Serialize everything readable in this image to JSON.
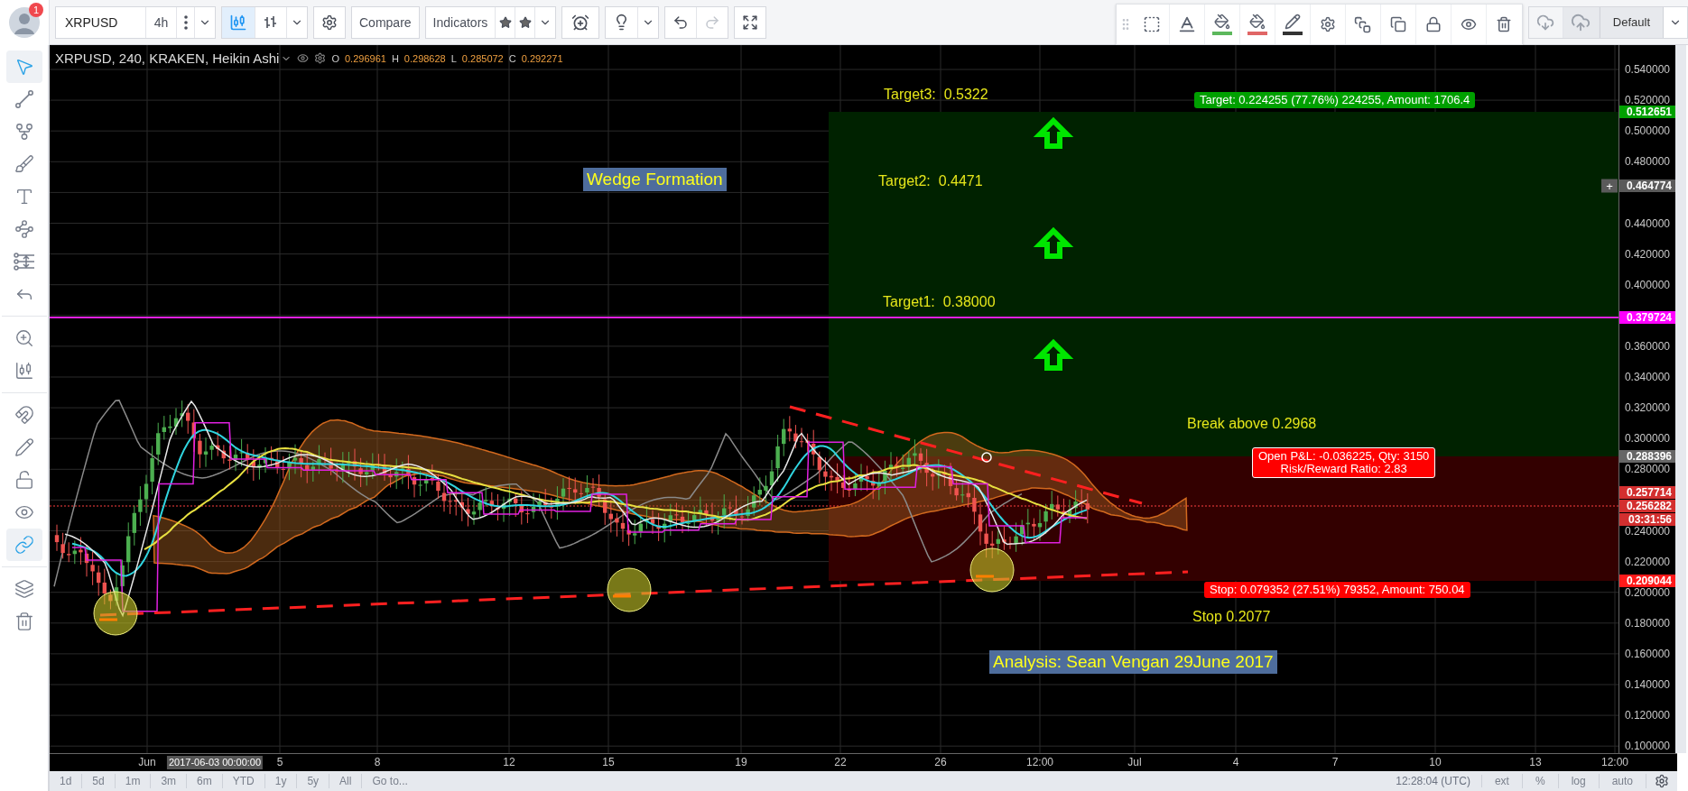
{
  "toolbar": {
    "avatar_badge": "1",
    "symbol": "XRPUSD",
    "interval": "4h",
    "chart_styles": [
      {
        "selected": true
      },
      {
        "selected": false
      }
    ],
    "buttons": [
      "Compare",
      "Indicators"
    ],
    "redo_disabled": true
  },
  "drawing_toolbar": {
    "style_colors": [
      {
        "color": "#5cb85c"
      },
      {
        "color": "#e06666"
      },
      {
        "color": "#333333"
      }
    ]
  },
  "layout": {
    "name": "Default"
  },
  "sidebar": {
    "tools": [
      {
        "active": true
      },
      {
        "active": false
      },
      {
        "active": false
      },
      {
        "active": false
      },
      {
        "active": false
      },
      {
        "active": false
      },
      {
        "active": false
      },
      {
        "active": false
      },
      {
        "active": false
      },
      {
        "active": false
      },
      {
        "active": false
      },
      {
        "active": false
      },
      {
        "active": false
      },
      {
        "active": false
      },
      {
        "active": true
      },
      {
        "active": false
      },
      {
        "active": false
      }
    ]
  },
  "legend": {
    "title": "XRPUSD, 240, KRAKEN, Heikin Ashi",
    "ohlc": [
      {
        "label": "O",
        "value": "0.296961"
      },
      {
        "label": "H",
        "value": "0.298628"
      },
      {
        "label": "L",
        "value": "0.285072"
      },
      {
        "label": "C",
        "value": "0.292271"
      }
    ]
  },
  "price_axis": {
    "ticks": [
      "0.540000",
      "0.520000",
      "0.500000",
      "0.480000",
      "0.440000",
      "0.420000",
      "0.400000",
      "0.360000",
      "0.340000",
      "0.320000",
      "0.300000",
      "0.280000",
      "0.240000",
      "0.220000",
      "0.200000",
      "0.180000",
      "0.160000",
      "0.140000",
      "0.120000",
      "0.100000"
    ],
    "tags": [
      {
        "text": "0.512651",
        "color": "#00a000"
      },
      {
        "text": "0.464774",
        "color": "#5a5a5a",
        "button": "+"
      },
      {
        "text": "0.379724",
        "color": "#ff00ff"
      },
      {
        "text": "0.288396",
        "color": "#666666"
      },
      {
        "text": "0.257714",
        "color": "#d32f2f"
      },
      {
        "text": "0.256282",
        "color": "#d32f2f"
      },
      {
        "text": "03:31:56",
        "color": "#d32f2f"
      },
      {
        "text": "0.209044",
        "color": "#ff1a1a"
      }
    ]
  },
  "time_axis": {
    "labels": [
      {
        "text": "Jun",
        "selected": false
      },
      {
        "text": "2017-06-03 00:00:00",
        "selected": true
      },
      {
        "text": "5",
        "selected": false
      },
      {
        "text": "8",
        "selected": false
      },
      {
        "text": "12",
        "selected": false
      },
      {
        "text": "15",
        "selected": false
      },
      {
        "text": "19",
        "selected": false
      },
      {
        "text": "22",
        "selected": false
      },
      {
        "text": "26",
        "selected": false
      },
      {
        "text": "12:00",
        "selected": false
      },
      {
        "text": "Jul",
        "selected": false
      },
      {
        "text": "4",
        "selected": false
      },
      {
        "text": "7",
        "selected": false
      },
      {
        "text": "10",
        "selected": false
      },
      {
        "text": "13",
        "selected": false
      },
      {
        "text": "12:00",
        "selected": false
      }
    ]
  },
  "annotations": [
    {
      "kind": "plain",
      "text": "Target3:  0.5322"
    },
    {
      "kind": "boxed",
      "text": "Wedge Formation"
    },
    {
      "kind": "plain",
      "text": "Target2:  0.4471"
    },
    {
      "kind": "plain",
      "text": "Target1:  0.38000"
    },
    {
      "kind": "plain",
      "text": "Break above 0.2968"
    },
    {
      "kind": "plain",
      "text": "Stop 0.2077"
    },
    {
      "kind": "boxed",
      "text": "Analysis: Sean Vengan 29June 2017"
    }
  ],
  "position": {
    "target": "Target: 0.224255 (77.76%) 224255, Amount: 1706.4",
    "pnl": [
      "Open P&L: -0.036225, Qty: 3150",
      "Risk/Reward Ratio: 2.83"
    ],
    "stop": "Stop: 0.079352 (27.51%) 79352, Amount: 750.04"
  },
  "ranges": [
    "1d",
    "5d",
    "1m",
    "3m",
    "6m",
    "YTD",
    "1y",
    "5y",
    "All",
    "Go to..."
  ],
  "status": {
    "clock": "12:28:04 (UTC)",
    "toggles": [
      "ext",
      "%",
      "log",
      "auto"
    ]
  }
}
